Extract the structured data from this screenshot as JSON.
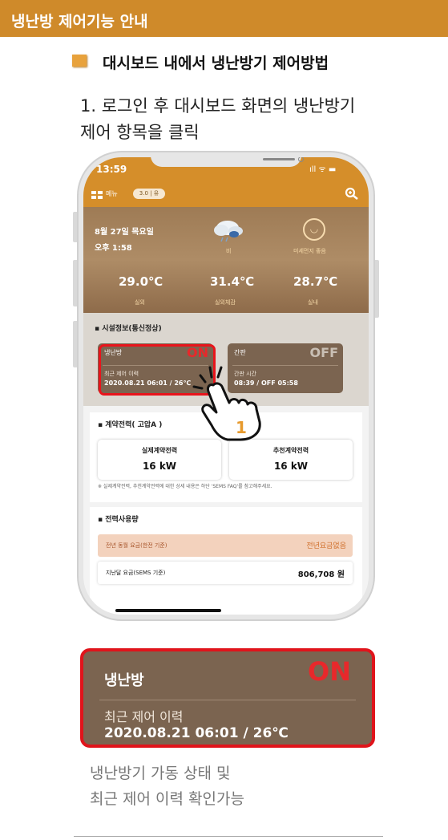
{
  "header": {
    "title": "냉난방 제어기능 안내"
  },
  "section": {
    "title": "대시보드 내에서 냉난방기 제어방법"
  },
  "step": {
    "line1": "1. 로그인 후 대시보드 화면의 냉난방기",
    "line2": "제어 항목을 클릭"
  },
  "phone": {
    "status_time": "13:59",
    "status_icons": "ıll ᯤ ▬",
    "menu_label": "메뉴",
    "version": "3.0 | 유",
    "weather": {
      "date": "8월 27일 목요일",
      "time": "오후 1:58",
      "condition": "비",
      "dust": "미세먼지 좋음",
      "temps": [
        {
          "value": "29.0℃",
          "label": "실외"
        },
        {
          "value": "31.4℃",
          "label": "실외체감"
        },
        {
          "value": "28.7℃",
          "label": "실내"
        }
      ]
    },
    "facility": {
      "title": "▪ 시설정보(통신정상)",
      "cards": [
        {
          "label": "냉난방",
          "state": "ON",
          "sub": "최근 제어 이력",
          "value": "2020.08.21 06:01 / 26℃"
        },
        {
          "label": "간판",
          "state": "OFF",
          "sub": "간판 시간",
          "value": "08:39 / OFF 05:58"
        }
      ]
    },
    "contract": {
      "title": "▪ 계약전력( 고압A )",
      "boxes": [
        {
          "label": "실제계약전력",
          "value": "16 kW"
        },
        {
          "label": "추천계약전력",
          "value": "16 kW"
        }
      ],
      "note": "※ 실제계약전력, 추천계약전력에 대한 상세 내용은 하단 'SEMS FAQ'를 참고해주세요."
    },
    "usage": {
      "title": "▪ 전력사용량",
      "row1_label": "전년 동월 요금(한전 기준)",
      "row1_value": "전년요금없음",
      "row2_label": "지난달 요금(SEMS 기준)",
      "row2_value": "806,708 원"
    },
    "hand_number": "1"
  },
  "zoom_card": {
    "label": "냉난방",
    "state": "ON",
    "sub": "최근 제어 이력",
    "value": "2020.08.21 06:01 / 26℃"
  },
  "caption": {
    "line1": "냉난방기 가동 상태 및",
    "line2": "최근 제어 이력 확인가능"
  },
  "colors": {
    "accent": "#cf8a2a",
    "card": "#7b6450",
    "highlight": "#e0141b",
    "on": "#e8282b"
  }
}
